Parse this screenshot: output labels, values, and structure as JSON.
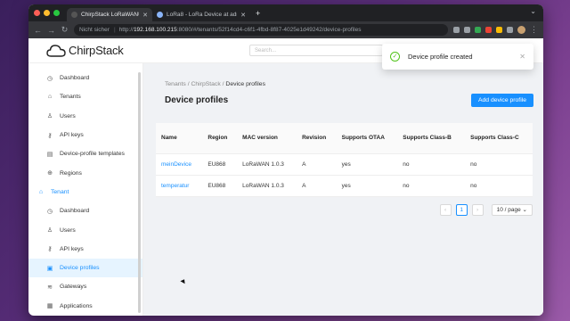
{
  "browser": {
    "tabs": [
      {
        "title": "ChirpStack LoRaWAN® Netwo",
        "active": true
      },
      {
        "title": "LoRa8 - LoRa Device at admi",
        "active": false
      }
    ],
    "url_security": "Nicht sicher",
    "url_host": "192.168.100.215",
    "url_rest": ":8080/#/tenants/52f14cd4-c6f1-4fbd-8f87-4025e1d49242/device-profiles"
  },
  "app": {
    "logo_text": "ChirpStack",
    "search_placeholder": "Search..."
  },
  "toast": {
    "message": "Device profile created"
  },
  "sidebar": {
    "items": [
      {
        "label": "Dashboard",
        "icon": "dashboard-icon",
        "glyph": "◷",
        "type": "sub"
      },
      {
        "label": "Tenants",
        "icon": "home-icon",
        "glyph": "⌂",
        "type": "sub"
      },
      {
        "label": "Users",
        "icon": "user-icon",
        "glyph": "♙",
        "type": "sub"
      },
      {
        "label": "API keys",
        "icon": "key-icon",
        "glyph": "⚷",
        "type": "sub"
      },
      {
        "label": "Device-profile templates",
        "icon": "template-icon",
        "glyph": "▤",
        "type": "sub"
      },
      {
        "label": "Regions",
        "icon": "region-icon",
        "glyph": "⊕",
        "type": "sub"
      },
      {
        "label": "Tenant",
        "icon": "tenant-home-icon",
        "glyph": "⌂",
        "type": "group"
      },
      {
        "label": "Dashboard",
        "icon": "dashboard-icon",
        "glyph": "◷",
        "type": "sub"
      },
      {
        "label": "Users",
        "icon": "user-icon",
        "glyph": "♙",
        "type": "sub"
      },
      {
        "label": "API keys",
        "icon": "key-icon",
        "glyph": "⚷",
        "type": "sub"
      },
      {
        "label": "Device profiles",
        "icon": "device-profile-icon",
        "glyph": "▣",
        "type": "sub",
        "active": true
      },
      {
        "label": "Gateways",
        "icon": "wifi-icon",
        "glyph": "≋",
        "type": "sub"
      },
      {
        "label": "Applications",
        "icon": "appstore-icon",
        "glyph": "▦",
        "type": "sub"
      }
    ]
  },
  "breadcrumb": {
    "items": [
      "Tenants",
      "ChirpStack",
      "Device profiles"
    ]
  },
  "page": {
    "title": "Device profiles",
    "add_button": "Add device profile"
  },
  "table": {
    "columns": [
      "Name",
      "Region",
      "MAC version",
      "Revision",
      "Supports OTAA",
      "Supports Class-B",
      "Supports Class-C"
    ],
    "rows": [
      [
        "meinDevice",
        "EU868",
        "LoRaWAN 1.0.3",
        "A",
        "yes",
        "no",
        "no"
      ],
      [
        "temperatur",
        "EU868",
        "LoRaWAN 1.0.3",
        "A",
        "yes",
        "no",
        "no"
      ]
    ]
  },
  "pagination": {
    "prev": "‹",
    "current": "1",
    "next": "›",
    "page_size": "10 / page"
  },
  "colors": {
    "primary": "#1890ff",
    "success": "#52c41a"
  }
}
